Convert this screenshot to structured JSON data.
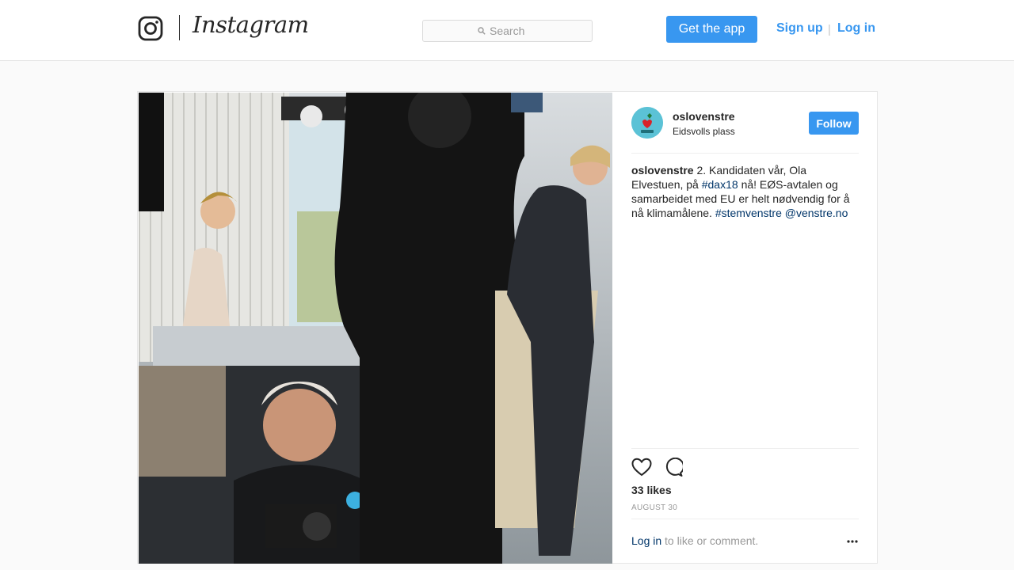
{
  "header": {
    "brand": "Instagram",
    "search_placeholder": "Search",
    "get_app_label": "Get the app",
    "signup_label": "Sign up",
    "separator": "|",
    "login_label": "Log in",
    "icons": [
      "instagram-camera-icon",
      "search-icon"
    ]
  },
  "post": {
    "username": "oslovenstre",
    "location": "Eidsvolls plass",
    "follow_label": "Follow",
    "caption": {
      "user": "oslovenstre",
      "text_1": "2. Kandidaten vår, Ola Elvestuen, på",
      "hashtag_1": "#dax18",
      "text_2": "nå! EØS-avtalen og samarbeidet med EU er helt nødvendig for å nå klimamålene.",
      "hashtag_2": "#stemvenstre",
      "mention": "@venstre.no"
    },
    "likes": "33 likes",
    "date": "AUGUST 30",
    "login_link": "Log in",
    "login_suffix": "to like or comment.",
    "icons": [
      "heart-icon",
      "comment-icon",
      "more-options-icon"
    ],
    "colors": {
      "accent": "#3897f0",
      "link": "#003569",
      "muted": "#999999"
    }
  }
}
